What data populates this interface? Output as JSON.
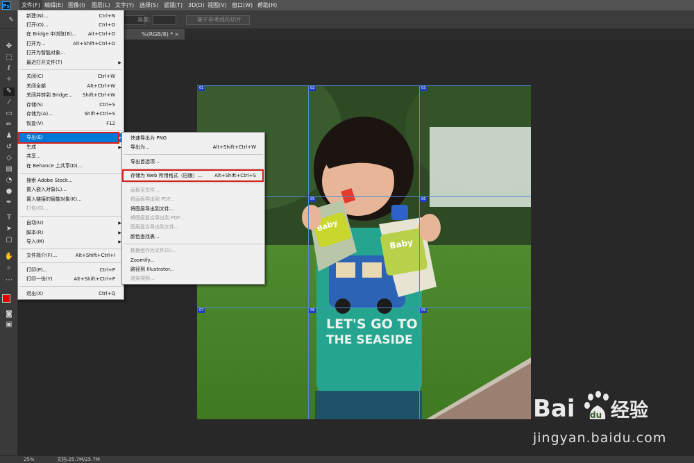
{
  "app": {
    "logo": "Ps"
  },
  "menubar": {
    "items": [
      "文件(F)",
      "编辑(E)",
      "图像(I)",
      "图层(L)",
      "文字(Y)",
      "选择(S)",
      "滤镜(T)",
      "3D(D)",
      "视图(V)",
      "窗口(W)",
      "帮助(H)"
    ]
  },
  "options_bar": {
    "height_label": "高度:",
    "slice_button": "基于参考线的切片"
  },
  "document": {
    "tab_title": "%(RGB/8) *",
    "close_glyph": "×"
  },
  "file_menu": {
    "items": [
      {
        "label": "新建(N)...",
        "shortcut": "Ctrl+N"
      },
      {
        "label": "打开(O)...",
        "shortcut": "Ctrl+O"
      },
      {
        "label": "在 Bridge 中浏览(B)...",
        "shortcut": "Alt+Ctrl+O"
      },
      {
        "label": "打开为...",
        "shortcut": "Alt+Shift+Ctrl+O"
      },
      {
        "label": "打开为智能对象...",
        "shortcut": ""
      },
      {
        "label": "最近打开文件(T)",
        "shortcut": ""
      },
      {
        "label": "关闭(C)",
        "shortcut": "Ctrl+W"
      },
      {
        "label": "关闭全部",
        "shortcut": "Alt+Ctrl+W"
      },
      {
        "label": "关闭并转到 Bridge...",
        "shortcut": "Shift+Ctrl+W"
      },
      {
        "label": "存储(S)",
        "shortcut": "Ctrl+S"
      },
      {
        "label": "存储为(A)...",
        "shortcut": "Shift+Ctrl+S"
      },
      {
        "label": "恢复(V)",
        "shortcut": "F12"
      },
      {
        "label": "导出(E)",
        "shortcut": ""
      },
      {
        "label": "生成",
        "shortcut": ""
      },
      {
        "label": "共享...",
        "shortcut": ""
      },
      {
        "label": "在 Behance 上共享(D)...",
        "shortcut": ""
      },
      {
        "label": "搜索 Adobe Stock...",
        "shortcut": ""
      },
      {
        "label": "置入嵌入对象(L)...",
        "shortcut": ""
      },
      {
        "label": "置入链接的智能对象(K)...",
        "shortcut": ""
      },
      {
        "label": "打包(G)...",
        "shortcut": ""
      },
      {
        "label": "自动(U)",
        "shortcut": ""
      },
      {
        "label": "脚本(R)",
        "shortcut": ""
      },
      {
        "label": "导入(M)",
        "shortcut": ""
      },
      {
        "label": "文件简介(F)...",
        "shortcut": "Alt+Shift+Ctrl+I"
      },
      {
        "label": "打印(P)...",
        "shortcut": "Ctrl+P"
      },
      {
        "label": "打印一份(Y)",
        "shortcut": "Alt+Shift+Ctrl+P"
      },
      {
        "label": "退出(X)",
        "shortcut": "Ctrl+Q"
      }
    ]
  },
  "export_menu": {
    "items": [
      {
        "label": "快速导出为 PNG",
        "shortcut": ""
      },
      {
        "label": "导出为...",
        "shortcut": "Alt+Shift+Ctrl+W"
      },
      {
        "label": "导出首选项...",
        "shortcut": ""
      },
      {
        "label": "存储为 Web 所用格式（旧版）...",
        "shortcut": "Alt+Shift+Ctrl+S"
      },
      {
        "label": "画板至文件...",
        "shortcut": ""
      },
      {
        "label": "将画板导出到 PDF...",
        "shortcut": ""
      },
      {
        "label": "将图层导出到文件...",
        "shortcut": ""
      },
      {
        "label": "将图层复合导出到 PDF...",
        "shortcut": ""
      },
      {
        "label": "图层复合导出到文件...",
        "shortcut": ""
      },
      {
        "label": "颜色查找表...",
        "shortcut": ""
      },
      {
        "label": "数据组作为文件(D)...",
        "shortcut": ""
      },
      {
        "label": "Zoomify...",
        "shortcut": ""
      },
      {
        "label": "路径到 Illustrator...",
        "shortcut": ""
      },
      {
        "label": "渲染视频...",
        "shortcut": ""
      }
    ]
  },
  "slices": [
    "01",
    "02",
    "03",
    "04",
    "05",
    "06",
    "07",
    "08",
    "09"
  ],
  "photo": {
    "shirt_text_1": "LET'S GO TO",
    "shirt_text_2": "THE SEASIDE",
    "pouch_text": "Baby"
  },
  "statusbar": {
    "zoom": "25%",
    "doc_info": "文档:25.7M/25.7M"
  },
  "watermark": {
    "brand_left": "Bai",
    "brand_cn": "经验",
    "url": "jingyan.baidu.com"
  },
  "colors": {
    "foreground": "#e00000",
    "background": "#ffffff",
    "menu_highlight": "#0078d7",
    "annotation_red": "#d91e18",
    "slice_blue": "#1e3fbd"
  }
}
